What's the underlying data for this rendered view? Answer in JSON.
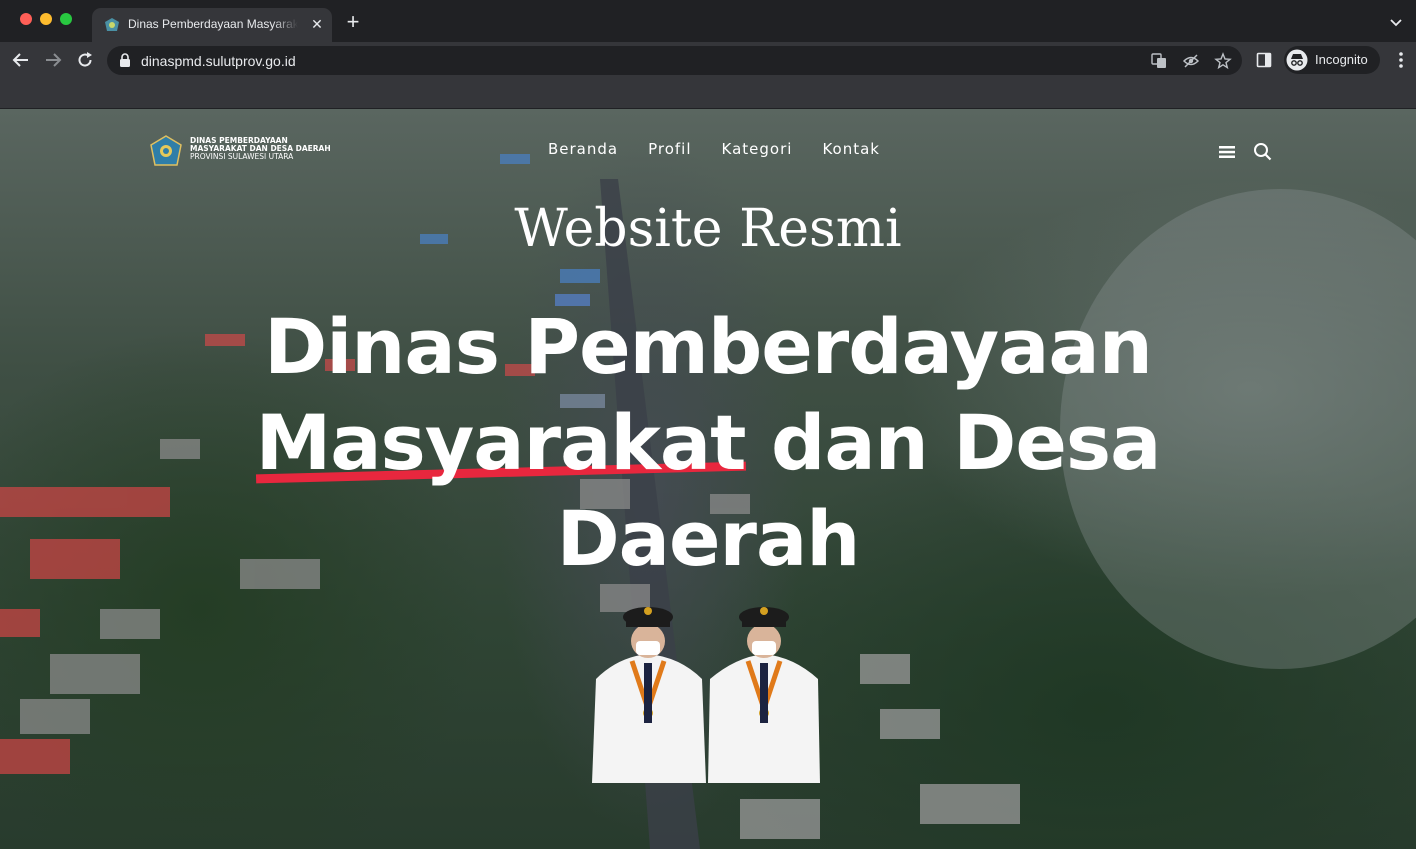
{
  "browser": {
    "tab": {
      "title": "Dinas Pemberdayaan Masyarakat dan Desa Daerah",
      "close": "✕"
    },
    "new_tab": "+",
    "url": "dinaspmd.sulutprov.go.id",
    "profile_label": "Incognito"
  },
  "site": {
    "brand": {
      "line1": "DINAS PEMBERDAYAAN",
      "line2": "MASYARAKAT DAN DESA DAERAH",
      "line3": "PROVINSI SULAWESI UTARA"
    },
    "nav": [
      {
        "label": "Beranda"
      },
      {
        "label": "Profil"
      },
      {
        "label": "Kategori"
      },
      {
        "label": "Kontak"
      }
    ],
    "hero": {
      "kicker": "Website Resmi",
      "headline_part1": "Dinas Pemberdayaan",
      "headline_highlight": "Masyarakat",
      "headline_part2": "dan Desa Daerah"
    }
  },
  "colors": {
    "accent": "#e8273e",
    "chrome_dark": "#202124",
    "chrome_toolbar": "#35363a",
    "text": "#ffffff"
  },
  "icons": [
    "favicon-icon",
    "close-icon",
    "plus-icon",
    "chevron-down-icon",
    "back-icon",
    "forward-icon",
    "reload-icon",
    "lock-icon",
    "translate-icon",
    "eye-off-icon",
    "star-icon",
    "side-panel-icon",
    "incognito-icon",
    "kebab-menu-icon",
    "hamburger-icon",
    "search-icon"
  ]
}
